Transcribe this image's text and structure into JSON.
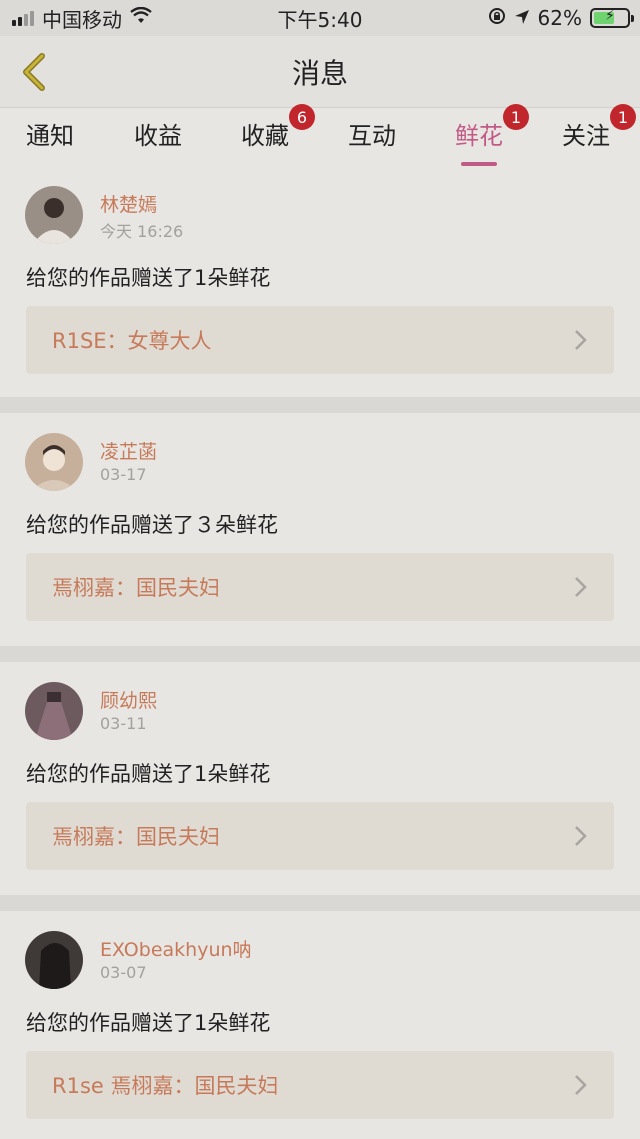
{
  "status": {
    "carrier": "中国移动",
    "time": "下午5:40",
    "battery": "62%",
    "battery_level": 0.62
  },
  "header": {
    "title": "消息"
  },
  "tabs": [
    {
      "label": "通知",
      "badge": ""
    },
    {
      "label": "收益",
      "badge": ""
    },
    {
      "label": "收藏",
      "badge": "6"
    },
    {
      "label": "互动",
      "badge": ""
    },
    {
      "label": "鲜花",
      "badge": "1",
      "active": true
    },
    {
      "label": "关注",
      "badge": "1"
    }
  ],
  "messages": [
    {
      "name": "林楚嫣",
      "date": "今天 16:26",
      "text": "给您的作品赠送了1朵鲜花",
      "work": "R1SE：女尊大人",
      "avatar_color": "#8a7d72"
    },
    {
      "name": "凌芷菡",
      "date": "03-17",
      "text": "给您的作品赠送了３朵鲜花",
      "work": "焉栩嘉：国民夫妇",
      "avatar_color": "#b29b86"
    },
    {
      "name": "顾幼熙",
      "date": "03-11",
      "text": "给您的作品赠送了1朵鲜花",
      "work": "焉栩嘉：国民夫妇",
      "avatar_color": "#6d5a5f"
    },
    {
      "name": "EXObeakhyun呐",
      "date": "03-07",
      "text": "给您的作品赠送了1朵鲜花",
      "work": "R1se 焉栩嘉：国民夫妇",
      "avatar_color": "#3f3a38"
    }
  ]
}
